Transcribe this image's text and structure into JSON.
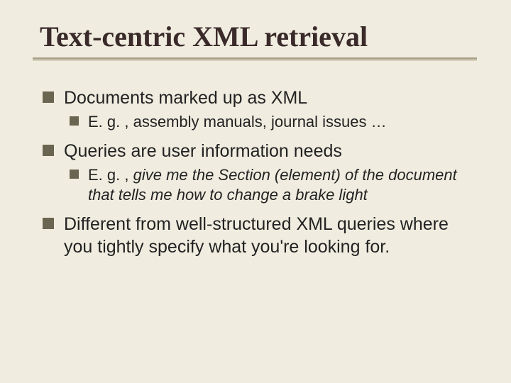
{
  "title": "Text-centric XML retrieval",
  "bullets": {
    "b1": "Documents marked up as XML",
    "b1a_strong": "E. g. , ",
    "b1a_rest": "assembly manuals, journal issues …",
    "b2": "Queries are user information needs",
    "b2a_strong": "E. g. , ",
    "b2a_rest": "give me the Section (element) of the document that tells me how to change a brake light",
    "b3": "Different from well-structured XML queries where you tightly specify what you're looking for."
  }
}
